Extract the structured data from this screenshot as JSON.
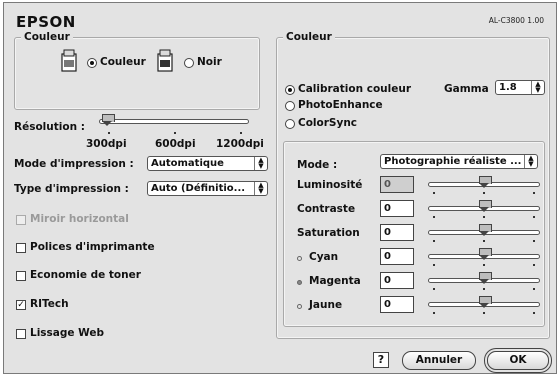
{
  "header": {
    "brand": "EPSON",
    "model": "AL-C3800 1.00"
  },
  "left": {
    "couleur_group": {
      "title": "Couleur",
      "option_color": "Couleur",
      "option_black": "Noir",
      "selected": "Couleur"
    },
    "resolution": {
      "label": "Résolution :",
      "ticks": [
        "300dpi",
        "600dpi",
        "1200dpi"
      ],
      "selected": "300dpi"
    },
    "print_mode": {
      "label": "Mode d'impression :",
      "value": "Automatique"
    },
    "print_type": {
      "label": "Type d'impression :",
      "value": "Auto (Définitio..."
    },
    "checkboxes": [
      {
        "label": "Miroir horizontal",
        "checked": false,
        "disabled": true
      },
      {
        "label": "Polices d'imprimante",
        "checked": false,
        "disabled": false
      },
      {
        "label": "Economie de toner",
        "checked": false,
        "disabled": false
      },
      {
        "label": "RITech",
        "checked": true,
        "disabled": false
      },
      {
        "label": "Lissage Web",
        "checked": false,
        "disabled": false
      }
    ],
    "check_mark": "✓"
  },
  "right": {
    "title": "Couleur",
    "options": [
      "Calibration couleur",
      "PhotoEnhance",
      "ColorSync"
    ],
    "selected": "Calibration couleur",
    "gamma": {
      "label": "Gamma",
      "value": "1.8"
    },
    "mode": {
      "label": "Mode :",
      "value": "Photographie réaliste ..."
    },
    "adjustments": [
      {
        "label": "Luminosité",
        "value": "0",
        "readonly": true,
        "marker": "none",
        "level": 0.5
      },
      {
        "label": "Contraste",
        "value": "0",
        "readonly": false,
        "marker": "none",
        "level": 0.5
      },
      {
        "label": "Saturation",
        "value": "0",
        "readonly": false,
        "marker": "none",
        "level": 0.5
      },
      {
        "label": "Cyan",
        "value": "0",
        "readonly": false,
        "marker": "open",
        "level": 0.5
      },
      {
        "label": "Magenta",
        "value": "0",
        "readonly": false,
        "marker": "filled",
        "level": 0.5
      },
      {
        "label": "Jaune",
        "value": "0",
        "readonly": false,
        "marker": "open",
        "level": 0.5
      }
    ]
  },
  "footer": {
    "help": "?",
    "cancel": "Annuler",
    "ok": "OK"
  },
  "colors": {
    "background": "#e3e3e3",
    "border": "#444444"
  }
}
